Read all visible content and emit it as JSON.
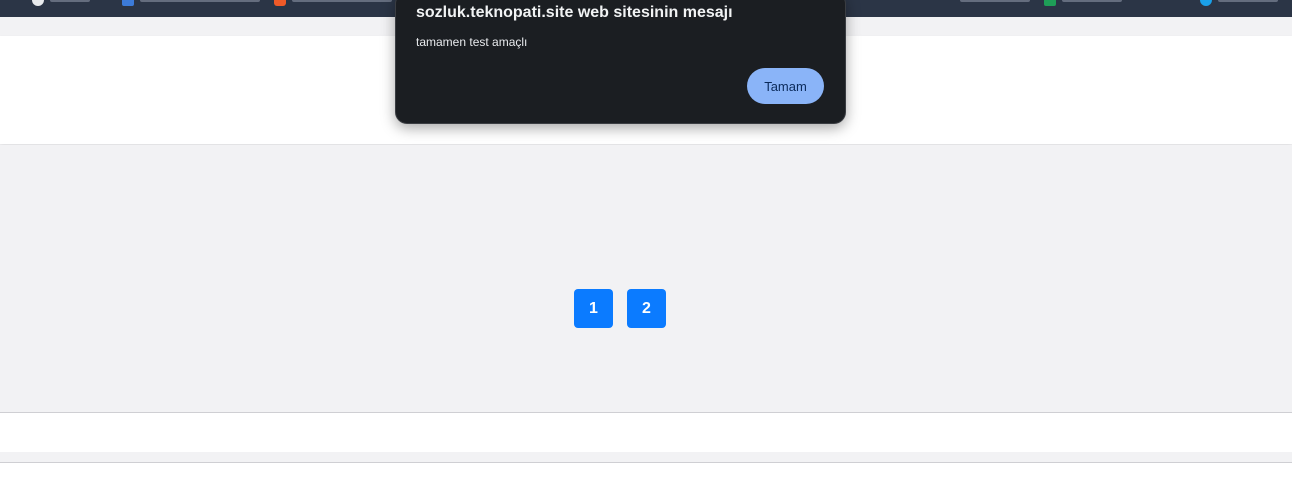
{
  "dialog": {
    "title": "sozluk.teknopati.site web sitesinin mesajı",
    "message": "tamamen test amaçlı",
    "ok_label": "Tamam"
  },
  "pagination": {
    "pages": [
      "1",
      "2"
    ]
  },
  "colors": {
    "bookmark_bar": "#2b3546",
    "page_button": "#0b7bff",
    "dialog_bg": "#1b1e22",
    "dialog_button": "#8ab4f8"
  }
}
